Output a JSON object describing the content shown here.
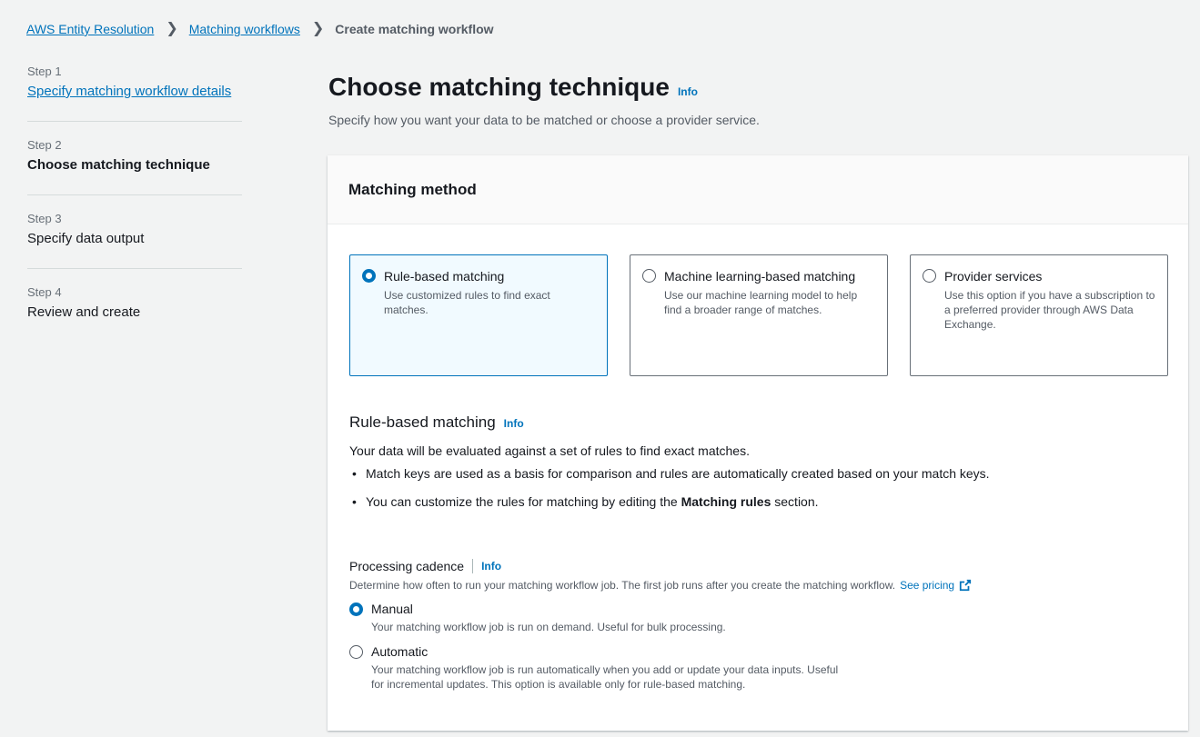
{
  "breadcrumb": {
    "items": [
      "AWS Entity Resolution",
      "Matching workflows"
    ],
    "current": "Create matching workflow"
  },
  "steps": [
    {
      "num": "Step 1",
      "title": "Specify matching workflow details"
    },
    {
      "num": "Step 2",
      "title": "Choose matching technique"
    },
    {
      "num": "Step 3",
      "title": "Specify data output"
    },
    {
      "num": "Step 4",
      "title": "Review and create"
    }
  ],
  "page": {
    "title": "Choose matching technique",
    "info": "Info",
    "description": "Specify how you want your data to be matched or choose a provider service."
  },
  "matching_method": {
    "header": "Matching method",
    "tiles": [
      {
        "label": "Rule-based matching",
        "desc": "Use customized rules to find exact matches.",
        "selected": true
      },
      {
        "label": "Machine learning-based matching",
        "desc": "Use our machine learning model to help find a broader range of matches.",
        "selected": false
      },
      {
        "label": "Provider services",
        "desc": "Use this option if you have a subscription to a preferred provider through AWS Data Exchange.",
        "selected": false
      }
    ]
  },
  "rule_section": {
    "title": "Rule-based matching",
    "info": "Info",
    "intro": "Your data will be evaluated against a set of rules to find exact matches.",
    "bullet1": "Match keys are used as a basis for comparison and rules are automatically created based on your match keys.",
    "bullet2_prefix": "You can customize the rules for matching by editing the ",
    "bullet2_bold": "Matching rules",
    "bullet2_suffix": " section."
  },
  "cadence": {
    "label": "Processing cadence",
    "info": "Info",
    "desc": "Determine how often to run your matching workflow job. The first job runs after you create the matching workflow.",
    "pricing_link": "See pricing",
    "options": [
      {
        "label": "Manual",
        "desc": "Your matching workflow job is run on demand. Useful for bulk processing.",
        "selected": true
      },
      {
        "label": "Automatic",
        "desc_line1": "Your matching workflow job is run automatically when you add or update your data inputs. Useful",
        "desc_line2": "for incremental updates. This option is available only for rule-based matching.",
        "selected": false
      }
    ]
  },
  "colors": {
    "accent": "#0073bb",
    "background": "#f2f3f3"
  }
}
